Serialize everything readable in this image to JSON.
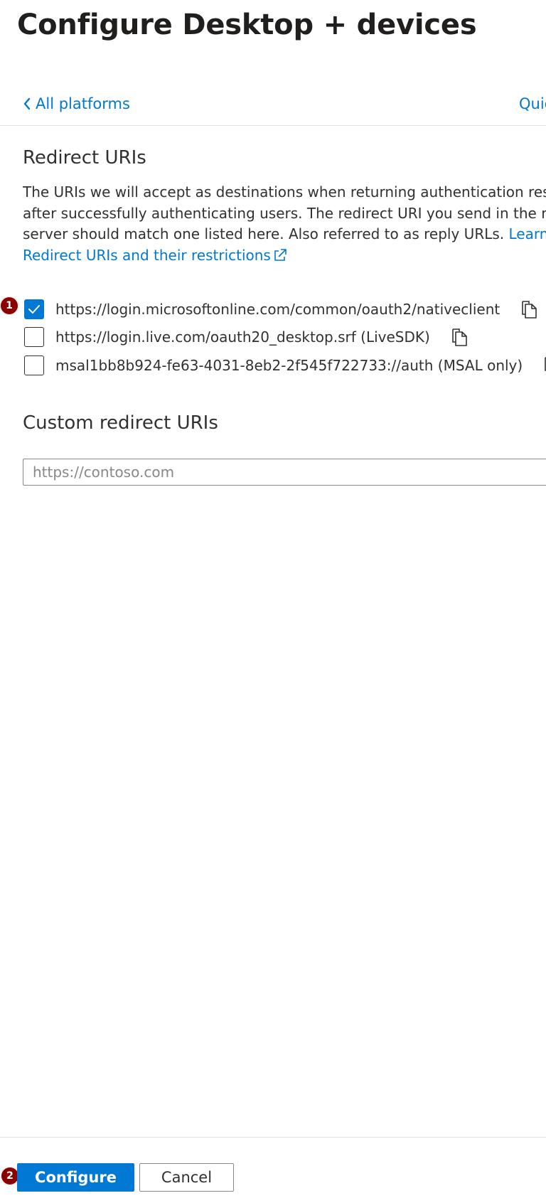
{
  "page": {
    "title": "Configure Desktop + devices"
  },
  "nav": {
    "back_label": "All platforms",
    "quickstart_label": "Quic"
  },
  "redirect": {
    "heading": "Redirect URIs",
    "description_lines": [
      "The URIs we will accept as destinations when returning authentication respon",
      "after successfully authenticating users. The redirect URI you send in the reque",
      "server should match one listed here. Also referred to as reply URLs. "
    ],
    "learn_more_label": "Learn mor",
    "restrictions_link_label": "Redirect URIs and their restrictions",
    "options": [
      {
        "uri": "https://login.microsoftonline.com/common/oauth2/nativeclient",
        "checked": true
      },
      {
        "uri": "https://login.live.com/oauth20_desktop.srf (LiveSDK)",
        "checked": false
      },
      {
        "uri": "msal1bb8b924-fe63-4031-8eb2-2f545f722733://auth (MSAL only)",
        "checked": false
      }
    ]
  },
  "custom": {
    "heading": "Custom redirect URIs",
    "placeholder": "https://contoso.com",
    "value": ""
  },
  "footer": {
    "configure_label": "Configure",
    "cancel_label": "Cancel"
  },
  "callouts": {
    "step1": "1",
    "step2": "2"
  },
  "colors": {
    "accent": "#0078d4",
    "callout": "#8b0000",
    "text": "#323130"
  },
  "icons": {
    "back": "chevron-left-icon",
    "external": "external-link-icon",
    "copy": "copy-icon",
    "check": "checkmark-icon"
  }
}
